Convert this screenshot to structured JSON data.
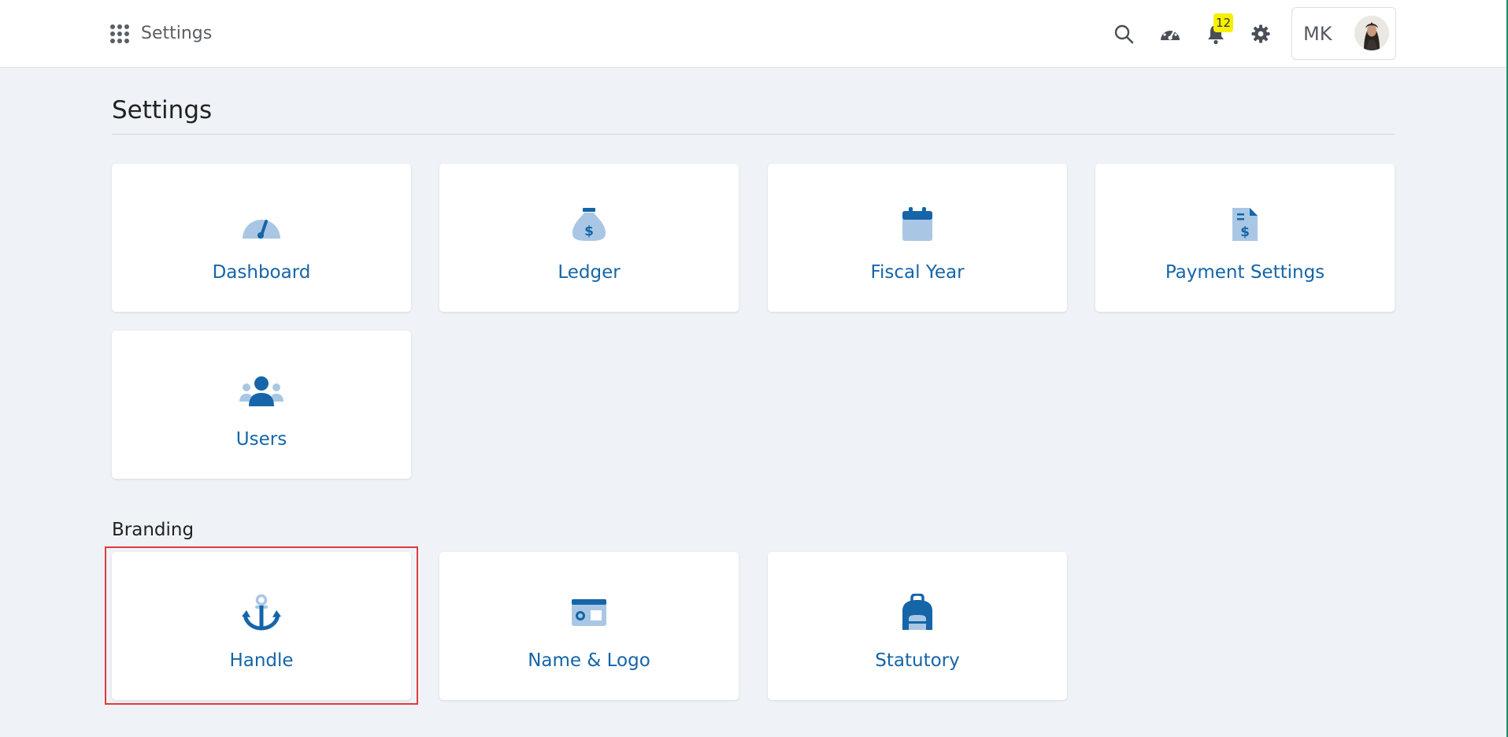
{
  "header": {
    "app_name": "Settings",
    "notification_count": "12",
    "user_initials": "MK"
  },
  "page": {
    "title": "Settings"
  },
  "settings_cards": [
    {
      "label": "Dashboard",
      "icon": "gauge-icon"
    },
    {
      "label": "Ledger",
      "icon": "money-bag-icon"
    },
    {
      "label": "Fiscal Year",
      "icon": "calendar-icon"
    },
    {
      "label": "Payment Settings",
      "icon": "invoice-icon"
    },
    {
      "label": "Users",
      "icon": "users-icon"
    }
  ],
  "branding": {
    "title": "Branding",
    "cards": [
      {
        "label": "Handle",
        "icon": "anchor-icon"
      },
      {
        "label": "Name & Logo",
        "icon": "id-card-icon"
      },
      {
        "label": "Statutory",
        "icon": "backpack-icon"
      }
    ]
  },
  "colors": {
    "accent": "#1565a8",
    "icon_light": "#a9c7e4",
    "highlight": "#e03a3a",
    "badge": "#f7ef00"
  }
}
